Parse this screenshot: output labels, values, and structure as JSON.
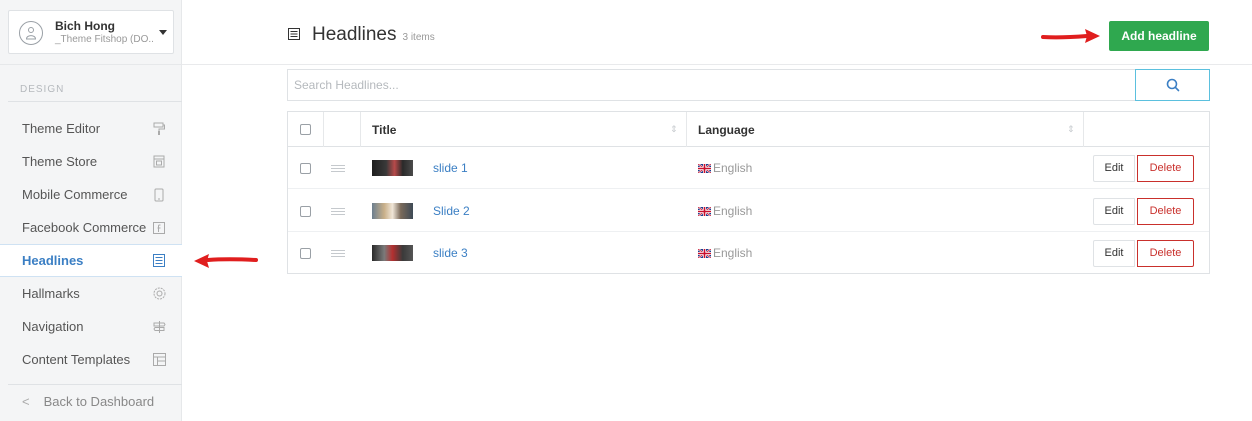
{
  "user": {
    "name": "Bich Hong",
    "shop": "_Theme Fitshop (DO.."
  },
  "sidebar": {
    "section_label": "DESIGN",
    "items": [
      {
        "label": "Theme Editor",
        "icon": "paint-roller-icon"
      },
      {
        "label": "Theme Store",
        "icon": "store-icon"
      },
      {
        "label": "Mobile Commerce",
        "icon": "mobile-icon"
      },
      {
        "label": "Facebook Commerce",
        "icon": "facebook-icon"
      },
      {
        "label": "Headlines",
        "icon": "headlines-icon",
        "active": true
      },
      {
        "label": "Hallmarks",
        "icon": "badge-icon"
      },
      {
        "label": "Navigation",
        "icon": "signpost-icon"
      },
      {
        "label": "Content Templates",
        "icon": "template-icon"
      }
    ],
    "back_label": "Back to Dashboard"
  },
  "header": {
    "title": "Headlines",
    "count": "3 items",
    "add_button": "Add headline"
  },
  "search": {
    "placeholder": "Search Headlines..."
  },
  "table": {
    "columns": {
      "title": "Title",
      "language": "Language"
    },
    "rows": [
      {
        "title": "slide 1",
        "language": "English"
      },
      {
        "title": "Slide 2",
        "language": "English"
      },
      {
        "title": "slide 3",
        "language": "English"
      }
    ],
    "edit_label": "Edit",
    "delete_label": "Delete"
  },
  "colors": {
    "accent": "#3b7fc4",
    "add_button": "#2fa84f",
    "delete": "#c9302c",
    "annotation_arrow": "#e01e1e"
  }
}
